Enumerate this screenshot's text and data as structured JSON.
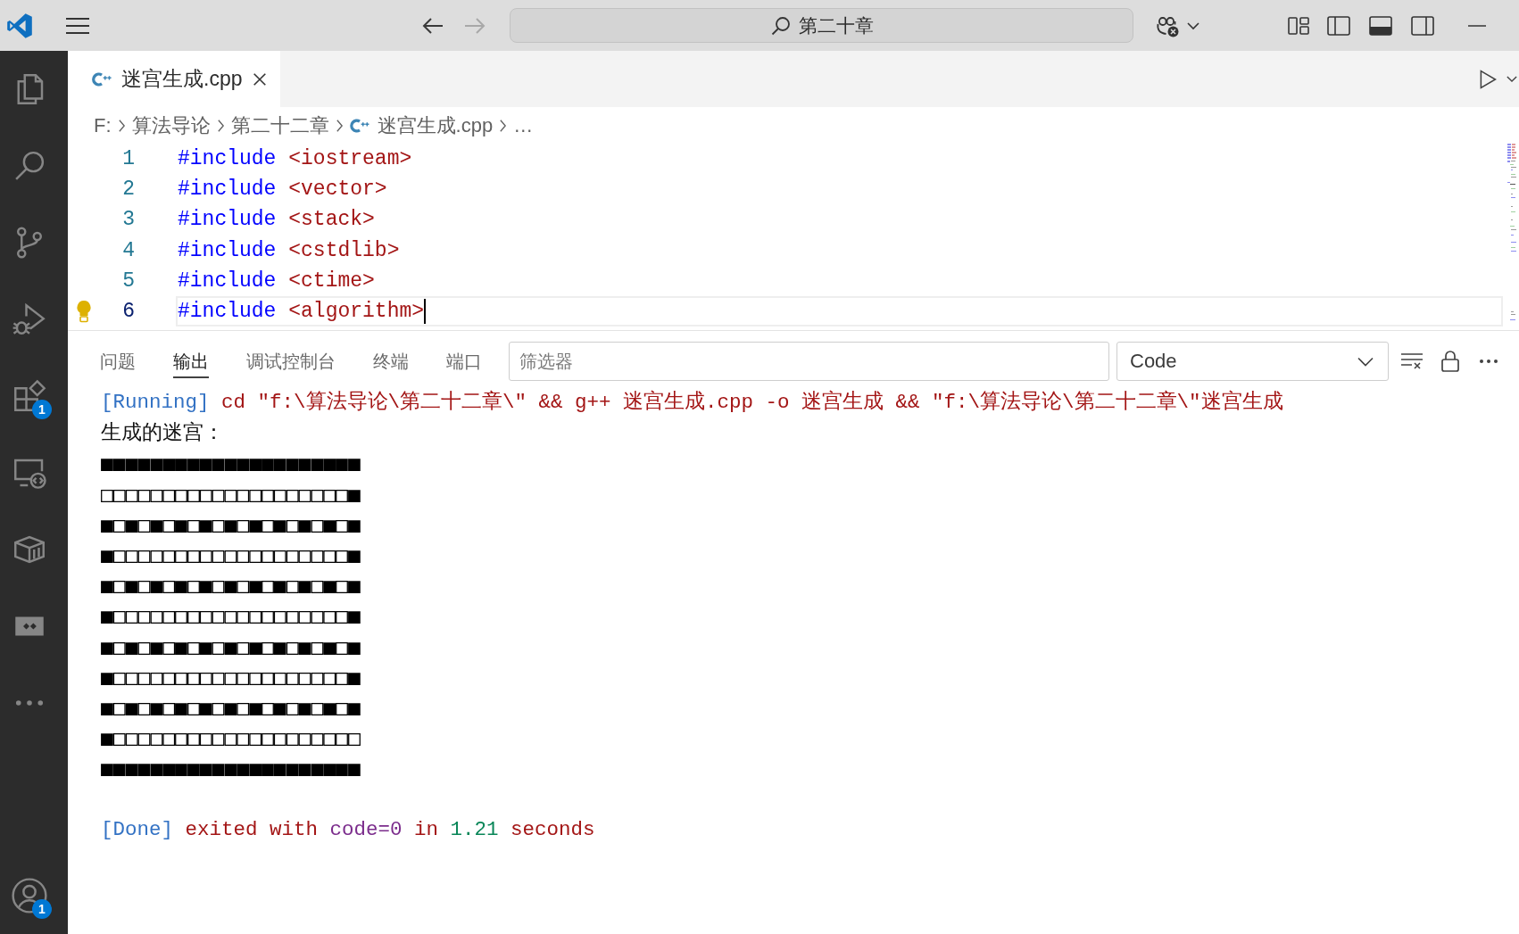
{
  "title_bar": {
    "navigation": [
      {
        "kind": "back",
        "disabled": false
      },
      {
        "kind": "forward",
        "disabled": true
      }
    ],
    "search": "第二十章"
  },
  "activity_bar": {
    "items": [
      {
        "kind": "explorer",
        "selected": false
      },
      {
        "kind": "search",
        "selected": false
      },
      {
        "kind": "source-control",
        "selected": false
      },
      {
        "kind": "run-debug",
        "selected": false
      },
      {
        "kind": "extensions",
        "selected": false,
        "badge": "1"
      },
      {
        "kind": "remote",
        "selected": false
      },
      {
        "kind": "containers",
        "selected": false
      },
      {
        "kind": "ports",
        "selected": false
      },
      {
        "kind": "more",
        "selected": false
      }
    ],
    "account": {
      "badge": "1"
    }
  },
  "editor": {
    "tabs": [
      {
        "label": "迷宫生成.cpp",
        "selected": true
      }
    ],
    "breadcrumbs": [
      {
        "kind": "folder",
        "label": "F:"
      },
      {
        "kind": "folder",
        "label": "算法导论"
      },
      {
        "kind": "folder",
        "label": "第二十二章"
      },
      {
        "kind": "file",
        "label": "迷宫生成.cpp"
      },
      {
        "kind": "symbol",
        "label": "…"
      }
    ],
    "lines": [
      {
        "number": "1",
        "current": false,
        "segments": [
          {
            "kind": "directive",
            "text": "#include "
          },
          {
            "kind": "header",
            "text": "<iostream>"
          }
        ]
      },
      {
        "number": "2",
        "current": false,
        "segments": [
          {
            "kind": "directive",
            "text": "#include "
          },
          {
            "kind": "header",
            "text": "<vector>"
          }
        ]
      },
      {
        "number": "3",
        "current": false,
        "segments": [
          {
            "kind": "directive",
            "text": "#include "
          },
          {
            "kind": "header",
            "text": "<stack>"
          }
        ]
      },
      {
        "number": "4",
        "current": false,
        "segments": [
          {
            "kind": "directive",
            "text": "#include "
          },
          {
            "kind": "header",
            "text": "<cstdlib>"
          }
        ]
      },
      {
        "number": "5",
        "current": false,
        "segments": [
          {
            "kind": "directive",
            "text": "#include "
          },
          {
            "kind": "header",
            "text": "<ctime>"
          }
        ]
      },
      {
        "number": "6",
        "current": true,
        "segments": [
          {
            "kind": "directive",
            "text": "#include "
          },
          {
            "kind": "header",
            "text": "<algorithm>"
          }
        ]
      }
    ]
  },
  "panel": {
    "tabs": [
      {
        "label": "问题",
        "selected": false
      },
      {
        "label": "输出",
        "selected": true
      },
      {
        "label": "调试控制台",
        "selected": false
      },
      {
        "label": "终端",
        "selected": false
      },
      {
        "label": "端口",
        "selected": false
      }
    ],
    "filter": {
      "placeholder": "筛选器"
    },
    "channel": "Code",
    "output": [
      {
        "kind": "command",
        "segments": [
          {
            "kind": "tag",
            "text": "[Running]"
          },
          {
            "kind": "text",
            "text": " cd \"f:\\算法导论\\第二十二章\\\" && g++ 迷宫生成.cpp -o 迷宫生成 && \"f:\\算法导论\\第二十二章\\\"迷宫生成"
          }
        ]
      },
      {
        "kind": "stdout",
        "text": "生成的迷宫："
      },
      {
        "kind": "maze",
        "text": "■■■■■■■■■■■■■■■■■■■■■"
      },
      {
        "kind": "maze",
        "text": "□□□□□□□□□□□□□□□□□□□□■"
      },
      {
        "kind": "maze",
        "text": "■□■□■□■□■□■□■□■□■□■□■"
      },
      {
        "kind": "maze",
        "text": "■□□□□□□□□□□□□□□□□□□□■"
      },
      {
        "kind": "maze",
        "text": "■□■□■□■□■□■□■□■□■□■□■"
      },
      {
        "kind": "maze",
        "text": "■□□□□□□□□□□□□□□□□□□□■"
      },
      {
        "kind": "maze",
        "text": "■□■□■□■□■□■□■□■□■□■□■"
      },
      {
        "kind": "maze",
        "text": "■□□□□□□□□□□□□□□□□□□□■"
      },
      {
        "kind": "maze",
        "text": "■□■□■□■□■□■□■□■□■□■□■"
      },
      {
        "kind": "maze",
        "text": "■□□□□□□□□□□□□□□□□□□□□"
      },
      {
        "kind": "maze",
        "text": "■■■■■■■■■■■■■■■■■■■■■"
      },
      {
        "kind": "result",
        "segments": [
          {
            "kind": "tag",
            "text": "[Done]"
          },
          {
            "kind": "text",
            "text": " exited with "
          },
          {
            "kind": "keyword",
            "text": "code=0"
          },
          {
            "kind": "text",
            "text": " in "
          },
          {
            "kind": "number",
            "text": "1.21"
          },
          {
            "kind": "text",
            "text": " seconds"
          }
        ]
      }
    ]
  }
}
